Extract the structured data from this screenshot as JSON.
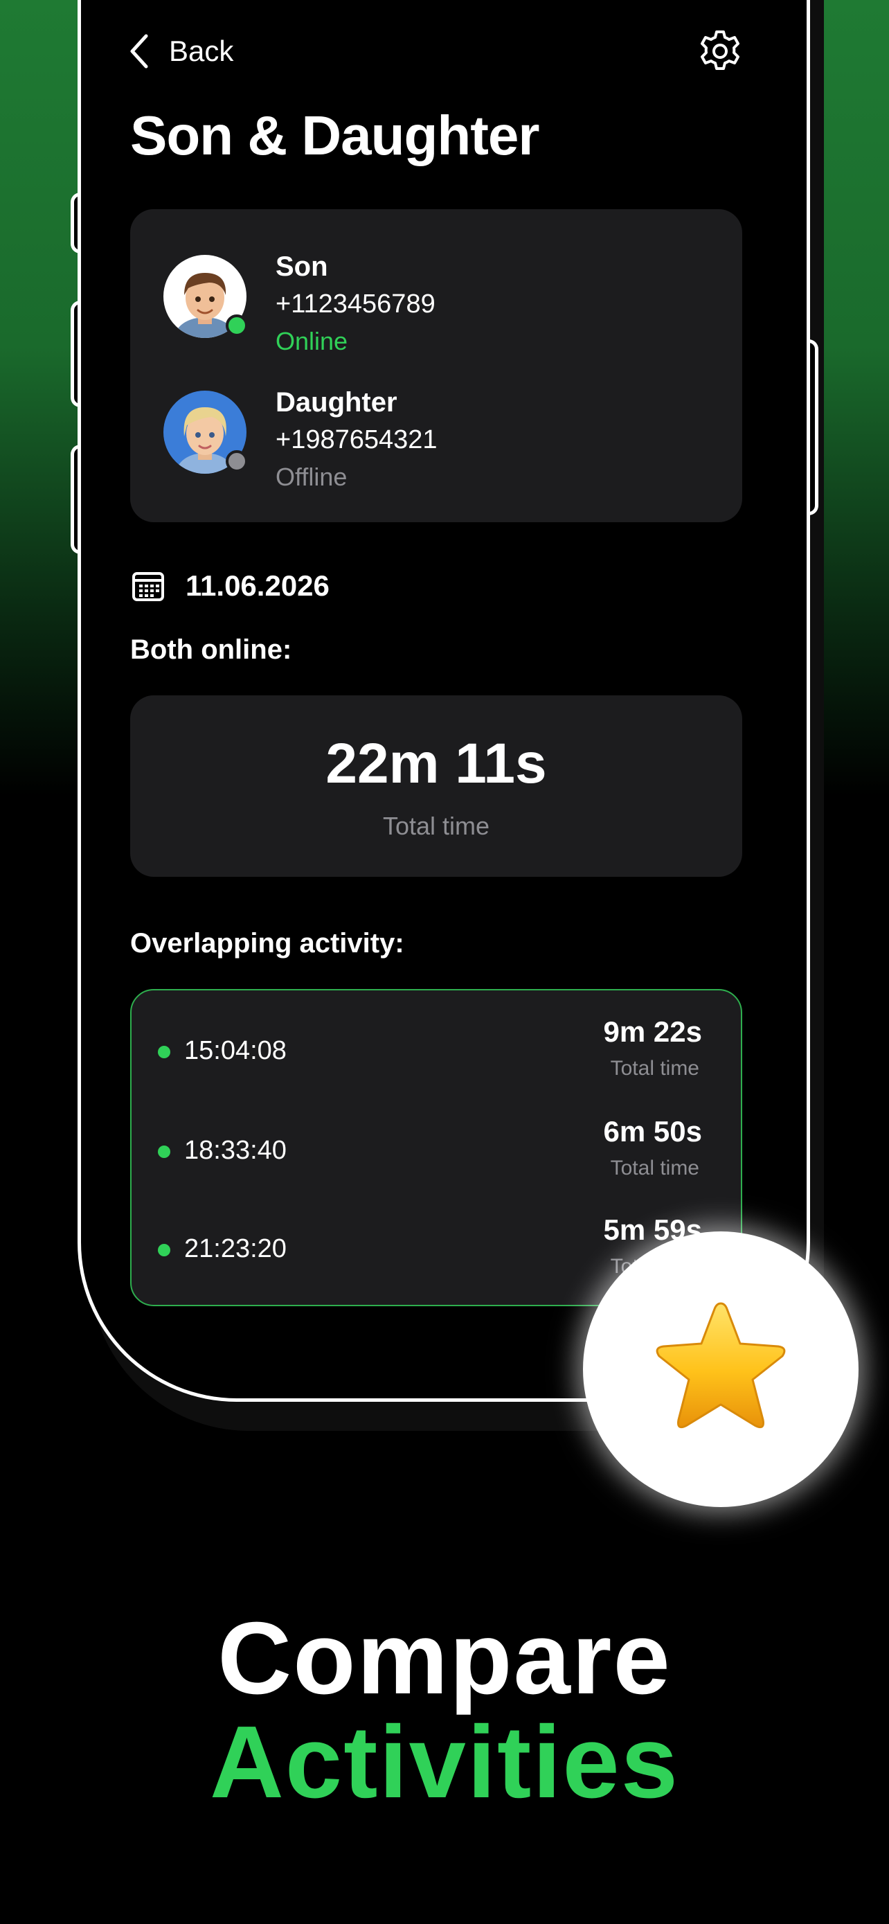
{
  "nav": {
    "back_label": "Back"
  },
  "page": {
    "title": "Son & Daughter"
  },
  "contacts": [
    {
      "name": "Son",
      "phone": "+1123456789",
      "status": "Online",
      "status_color": "#30d158"
    },
    {
      "name": "Daughter",
      "phone": "+1987654321",
      "status": "Offline",
      "status_color": "#8e8e93"
    }
  ],
  "date": "11.06.2026",
  "both_online": {
    "label": "Both online:",
    "total": "22m 11s",
    "caption": "Total time"
  },
  "overlap": {
    "label": "Overlapping activity:",
    "items": [
      {
        "time": "15:04:08",
        "duration": "9m 22s",
        "caption": "Total time"
      },
      {
        "time": "18:33:40",
        "duration": "6m 50s",
        "caption": "Total time"
      },
      {
        "time": "21:23:20",
        "duration": "5m 59s",
        "caption": "Total time"
      }
    ]
  },
  "headline": {
    "line1": "Compare",
    "line2": "Activities"
  },
  "colors": {
    "accent": "#30d158",
    "card": "#1c1c1e",
    "muted": "#8e8e93"
  }
}
